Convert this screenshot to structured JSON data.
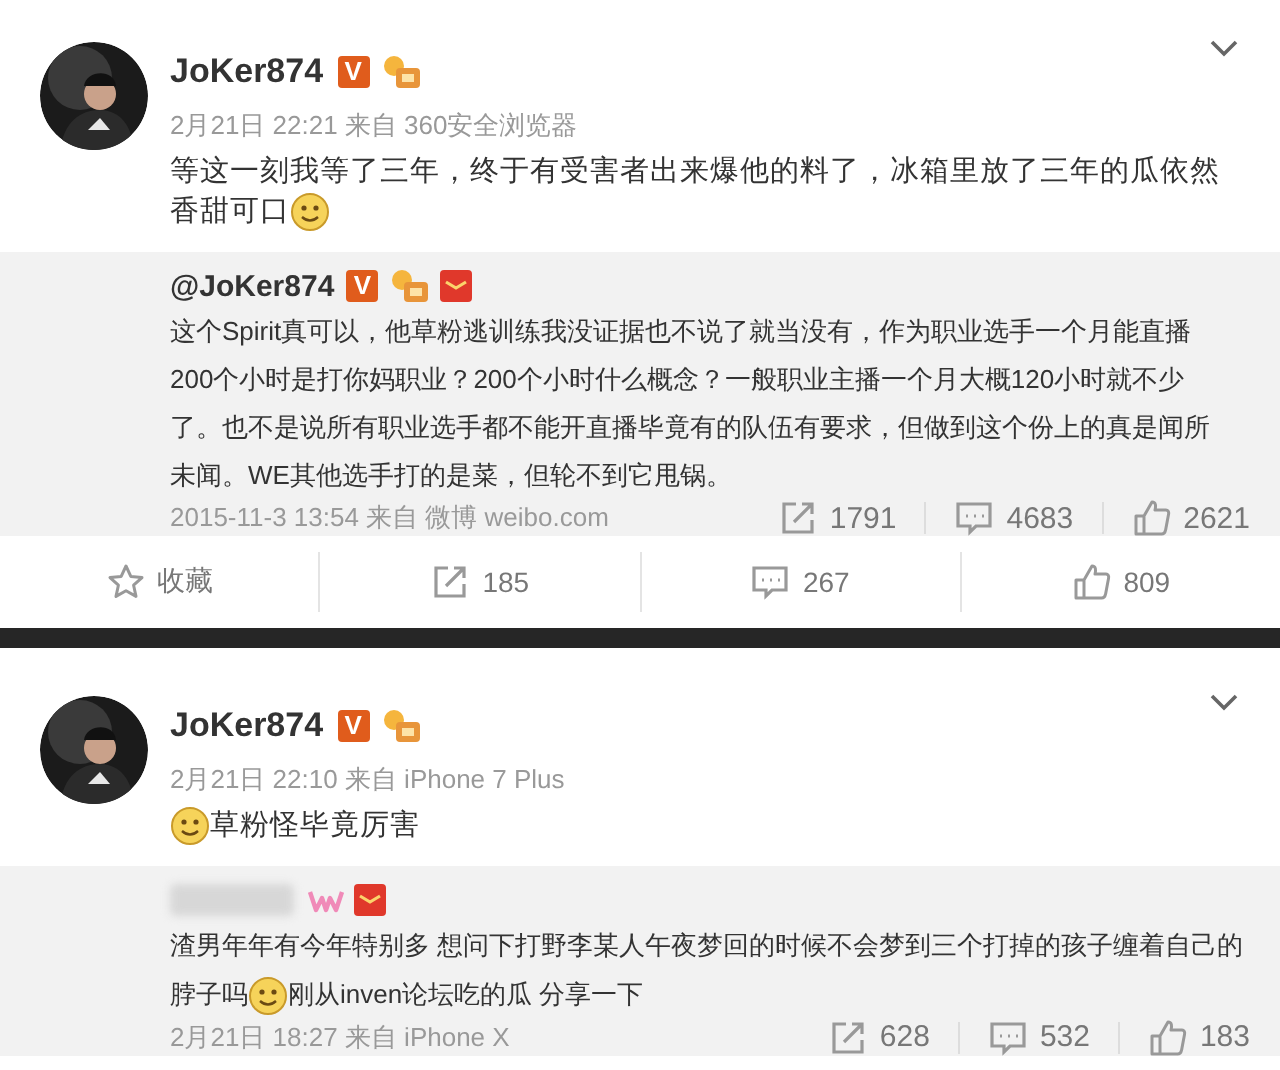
{
  "posts": [
    {
      "author": "JoKer874",
      "badges": [
        {
          "kind": "verified",
          "text": "V"
        },
        {
          "kind": "medal"
        }
      ],
      "meta": "2月21日 22:21 来自 360安全浏览器",
      "content": [
        {
          "kind": "line",
          "text": "等这一刻我等了三年，终于有受害者出来爆他的料了，冰箱里放了三年的瓜依然"
        },
        {
          "kind": "text",
          "text": "香甜可口"
        },
        {
          "kind": "emoji"
        }
      ],
      "repost": {
        "author_blurred": false,
        "author": "@JoKer874",
        "badges": [
          {
            "kind": "verified",
            "text": "V"
          },
          {
            "kind": "medal"
          },
          {
            "kind": "redpack"
          }
        ],
        "content": [
          {
            "kind": "para",
            "text": "这个Spirit真可以，他草粉逃训练我没证据也不说了就当没有，作为职业选手一个月能直播200个小时是打你妈职业？200个小时什么概念？一般职业主播一个月大概120小时就不少了。也不是说所有职业选手都不能开直播毕竟有的队伍有要求，但做到这个份上的真是闻所未闻。WE其他选手打的是菜，但轮不到它甩锅。"
          }
        ],
        "meta": "2015-11-3 13:54 来自 微博 weibo.com",
        "stats": [
          {
            "kind": "share",
            "text": "1791"
          },
          {
            "kind": "comment",
            "text": "4683"
          },
          {
            "kind": "like",
            "text": "2621"
          }
        ]
      },
      "actions": [
        {
          "kind": "favorite",
          "text": "收藏"
        },
        {
          "kind": "share",
          "text": "185"
        },
        {
          "kind": "comment",
          "text": "267"
        },
        {
          "kind": "like",
          "text": "809"
        }
      ]
    },
    {
      "author": "JoKer874",
      "badges": [
        {
          "kind": "verified",
          "text": "V"
        },
        {
          "kind": "medal"
        }
      ],
      "meta": "2月21日 22:10 来自 iPhone 7 Plus",
      "content": [
        {
          "kind": "emoji"
        },
        {
          "kind": "text",
          "text": "草粉怪毕竟厉害"
        }
      ],
      "repost": {
        "author_blurred": true,
        "badges": [
          {
            "kind": "member"
          },
          {
            "kind": "redpack"
          }
        ],
        "content": [
          {
            "kind": "line",
            "text": "渣男年年有今年特别多 想问下打野李某人午夜梦回的时候不会梦到三个打掉的孩子缠着自己的"
          },
          {
            "kind": "text",
            "text": "脖子吗"
          },
          {
            "kind": "emoji"
          },
          {
            "kind": "text",
            "text": "刚从inven论坛吃的瓜 分享一下"
          }
        ],
        "meta": "2月21日 18:27 来自 iPhone X",
        "stats": [
          {
            "kind": "share",
            "text": "628"
          },
          {
            "kind": "comment",
            "text": "532"
          },
          {
            "kind": "like",
            "text": "183"
          }
        ]
      }
    }
  ]
}
